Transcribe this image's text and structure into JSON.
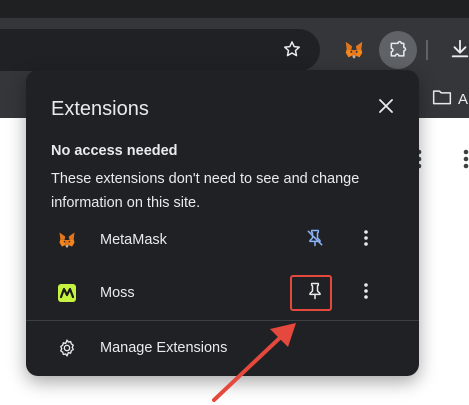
{
  "colors": {
    "popup_bg": "#202124",
    "text": "#e8eaed",
    "pin_active": "#8ab4f8",
    "highlight": "#e5483c"
  },
  "toolbar": {
    "icons": [
      "star-icon",
      "metamask-icon",
      "extensions-puzzle-icon",
      "download-icon"
    ]
  },
  "bookmarks": {
    "item_label": "A"
  },
  "popup": {
    "title": "Extensions",
    "close_icon": "close-icon",
    "section": {
      "heading": "No access needed",
      "description": "These extensions don't need to see and change information on this site."
    },
    "extensions": [
      {
        "name": "MetaMask",
        "icon": "metamask-icon",
        "pinned": true
      },
      {
        "name": "Moss",
        "icon": "moss-icon",
        "pinned": false
      }
    ],
    "manage_label": "Manage Extensions"
  }
}
